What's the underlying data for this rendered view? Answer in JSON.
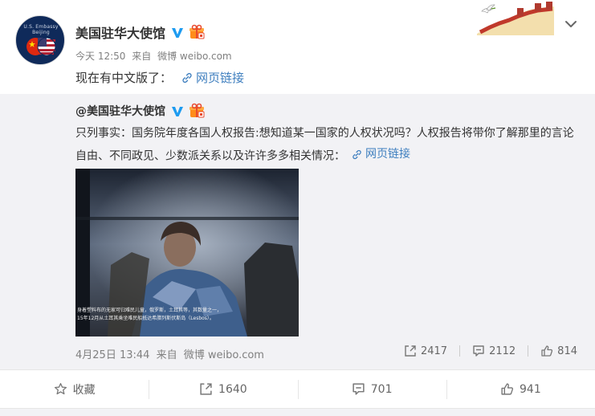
{
  "post": {
    "author": "美国驻华大使馆",
    "avatar_text": "U.S. Embassy Beijing",
    "meta": {
      "time": "今天 12:50",
      "from_label": "来自",
      "source": "微博 weibo.com"
    },
    "text": "现在有中文版了：",
    "link_label": "网页链接",
    "icons": [
      "verified-badge-icon",
      "gift-badge-icon",
      "great-wall-dove-decoration",
      "chevron-down-icon"
    ]
  },
  "repost": {
    "author": "@美国驻华大使馆",
    "text": "只列事实：国务院年度各国人权报告:想知道某一国家的人权状况吗？人权报告将带你了解那里的言论自由、不同政见、少数派关系以及许许多多相关情况：",
    "link_label": "网页链接",
    "photo_caption_1": "身着塑料布的无家可归难民儿童，俄罗斯，土耳其等，其数量之一，",
    "photo_caption_2": "15年12月从土耳其乘坐难民船抵达希腊列斯伏斯岛（Lesbos）。",
    "meta": {
      "time": "4月25日 13:44",
      "from_label": "来自",
      "source": "微博 weibo.com"
    },
    "reposts": "2417",
    "comments": "2112",
    "likes": "814"
  },
  "actions": {
    "favorite": "收藏",
    "repost": "1640",
    "comment": "701",
    "like": "941"
  },
  "colors": {
    "link": "#3f7fbf",
    "verified": "#1d9bf0",
    "repost_bg": "#f2f2f5",
    "muted": "#808080"
  }
}
